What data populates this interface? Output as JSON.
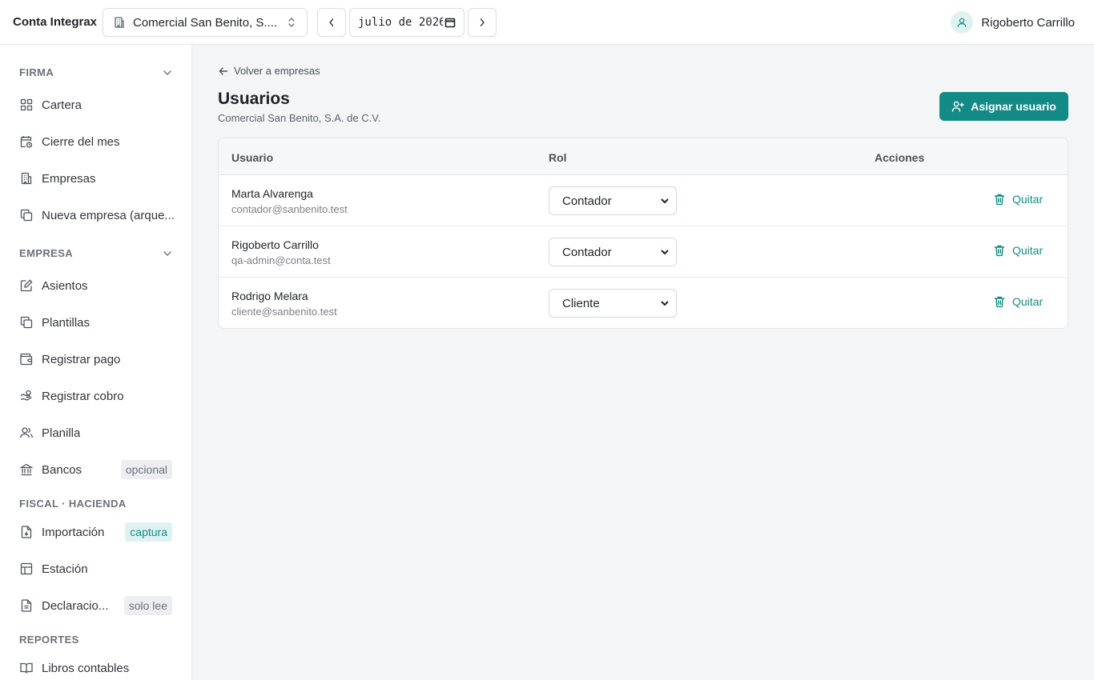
{
  "header": {
    "brand": "Conta Integrax",
    "company_selector": "Comercial San Benito, S....",
    "period": "julio de 2026",
    "user_name": "Rigoberto Carrillo"
  },
  "sidebar": {
    "sections": [
      {
        "title": "FIRMA",
        "collapsible": true,
        "items": [
          {
            "label": "Cartera",
            "icon": "grid-icon"
          },
          {
            "label": "Cierre del mes",
            "icon": "calendar-clock-icon"
          },
          {
            "label": "Empresas",
            "icon": "building-icon"
          },
          {
            "label": "Nueva empresa (arque...",
            "icon": "copy-icon"
          }
        ]
      },
      {
        "title": "EMPRESA",
        "collapsible": true,
        "items": [
          {
            "label": "Asientos",
            "icon": "edit-document-icon"
          },
          {
            "label": "Plantillas",
            "icon": "copy-icon"
          },
          {
            "label": "Registrar pago",
            "icon": "wallet-icon"
          },
          {
            "label": "Registrar cobro",
            "icon": "hand-coins-icon"
          },
          {
            "label": "Planilla",
            "icon": "users-icon"
          },
          {
            "label": "Bancos",
            "icon": "bank-icon",
            "badge": "opcional"
          }
        ]
      },
      {
        "title": "FISCAL · HACIENDA",
        "collapsible": false,
        "items": [
          {
            "label": "Importación",
            "icon": "file-import-icon",
            "badge": "captura"
          },
          {
            "label": "Estación",
            "icon": "table-icon"
          },
          {
            "label": "Declaracio...",
            "icon": "file-text-icon",
            "badge": "solo lee"
          }
        ]
      },
      {
        "title": "REPORTES",
        "collapsible": false,
        "items": [
          {
            "label": "Libros contables",
            "icon": "book-icon"
          }
        ]
      }
    ]
  },
  "main": {
    "back_link": "Volver a empresas",
    "title": "Usuarios",
    "subtitle": "Comercial San Benito, S.A. de C.V.",
    "assign_button": "Asignar usuario",
    "table": {
      "columns": [
        "Usuario",
        "Rol",
        "Acciones"
      ],
      "rows": [
        {
          "name": "Marta Alvarenga",
          "email": "contador@sanbenito.test",
          "role": "Contador",
          "action": "Quitar"
        },
        {
          "name": "Rigoberto Carrillo",
          "email": "qa-admin@conta.test",
          "role": "Contador",
          "action": "Quitar"
        },
        {
          "name": "Rodrigo Melara",
          "email": "cliente@sanbenito.test",
          "role": "Cliente",
          "action": "Quitar"
        }
      ]
    }
  },
  "colors": {
    "accent": "#148a86",
    "accent_light": "#dff2f1",
    "background": "#f3f5f7"
  }
}
